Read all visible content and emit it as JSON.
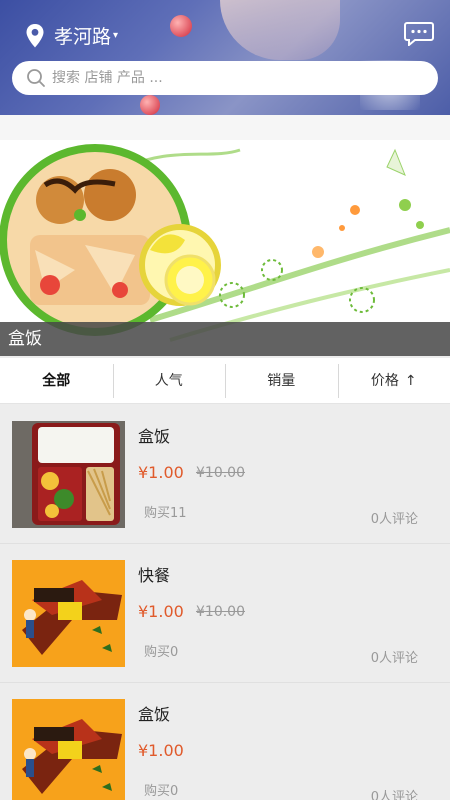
{
  "header": {
    "location": "孝河路",
    "search_placeholder": "搜索 店铺 产品 ..."
  },
  "banner": {
    "caption": "盒饭"
  },
  "tabs": [
    {
      "label": "全部",
      "active": true
    },
    {
      "label": "人气"
    },
    {
      "label": "销量"
    },
    {
      "label": "价格",
      "arrow": "↑"
    }
  ],
  "items": [
    {
      "name": "盒饭",
      "price": "¥1.00",
      "original_price": "¥10.00",
      "sold": "购买11",
      "reviews": "0人评论",
      "image": "boxed-rice-photo"
    },
    {
      "name": "快餐",
      "price": "¥1.00",
      "original_price": "¥10.00",
      "sold": "购买0",
      "reviews": "0人评论",
      "image": "fast-food-poster"
    },
    {
      "name": "盒饭",
      "price": "¥1.00",
      "original_price": "",
      "sold": "购买0",
      "reviews": "0人评论",
      "image": "fast-food-poster"
    }
  ],
  "colors": {
    "header_bg": "#3c4fa3",
    "price": "#e05a2b",
    "accent_green": "#5cb82e"
  }
}
